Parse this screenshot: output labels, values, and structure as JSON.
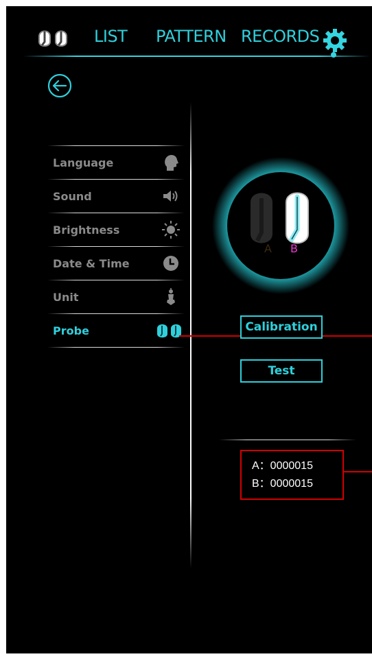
{
  "nav": {
    "tabs": [
      "LIST",
      "PATTERN",
      "RECORDS"
    ],
    "probe_icon": "probe-pair-icon",
    "settings_icon": "gear-icon",
    "active": "settings"
  },
  "back_icon": "arrow-left-circle-icon",
  "menu": {
    "items": [
      {
        "label": "Language",
        "icon": "head-silhouette-icon"
      },
      {
        "label": "Sound",
        "icon": "speaker-icon"
      },
      {
        "label": "Brightness",
        "icon": "sun-icon"
      },
      {
        "label": "Date & Time",
        "icon": "clock-icon"
      },
      {
        "label": "Unit",
        "icon": "figure-icon"
      },
      {
        "label": "Probe",
        "icon": "probe-pair-icon",
        "active": true
      }
    ]
  },
  "probe_panel": {
    "label_a": "A",
    "label_b": "B",
    "selected": "B"
  },
  "buttons": {
    "calibration": "Calibration",
    "test": "Test"
  },
  "counts": {
    "a": "A：0000015",
    "b": "B：0000015"
  },
  "colors": {
    "accent": "#2fd0dc",
    "background": "#000000",
    "menu_text": "#8a8a8a",
    "selected_probe_label": "#e83ad0",
    "annotation": "#d40000"
  }
}
